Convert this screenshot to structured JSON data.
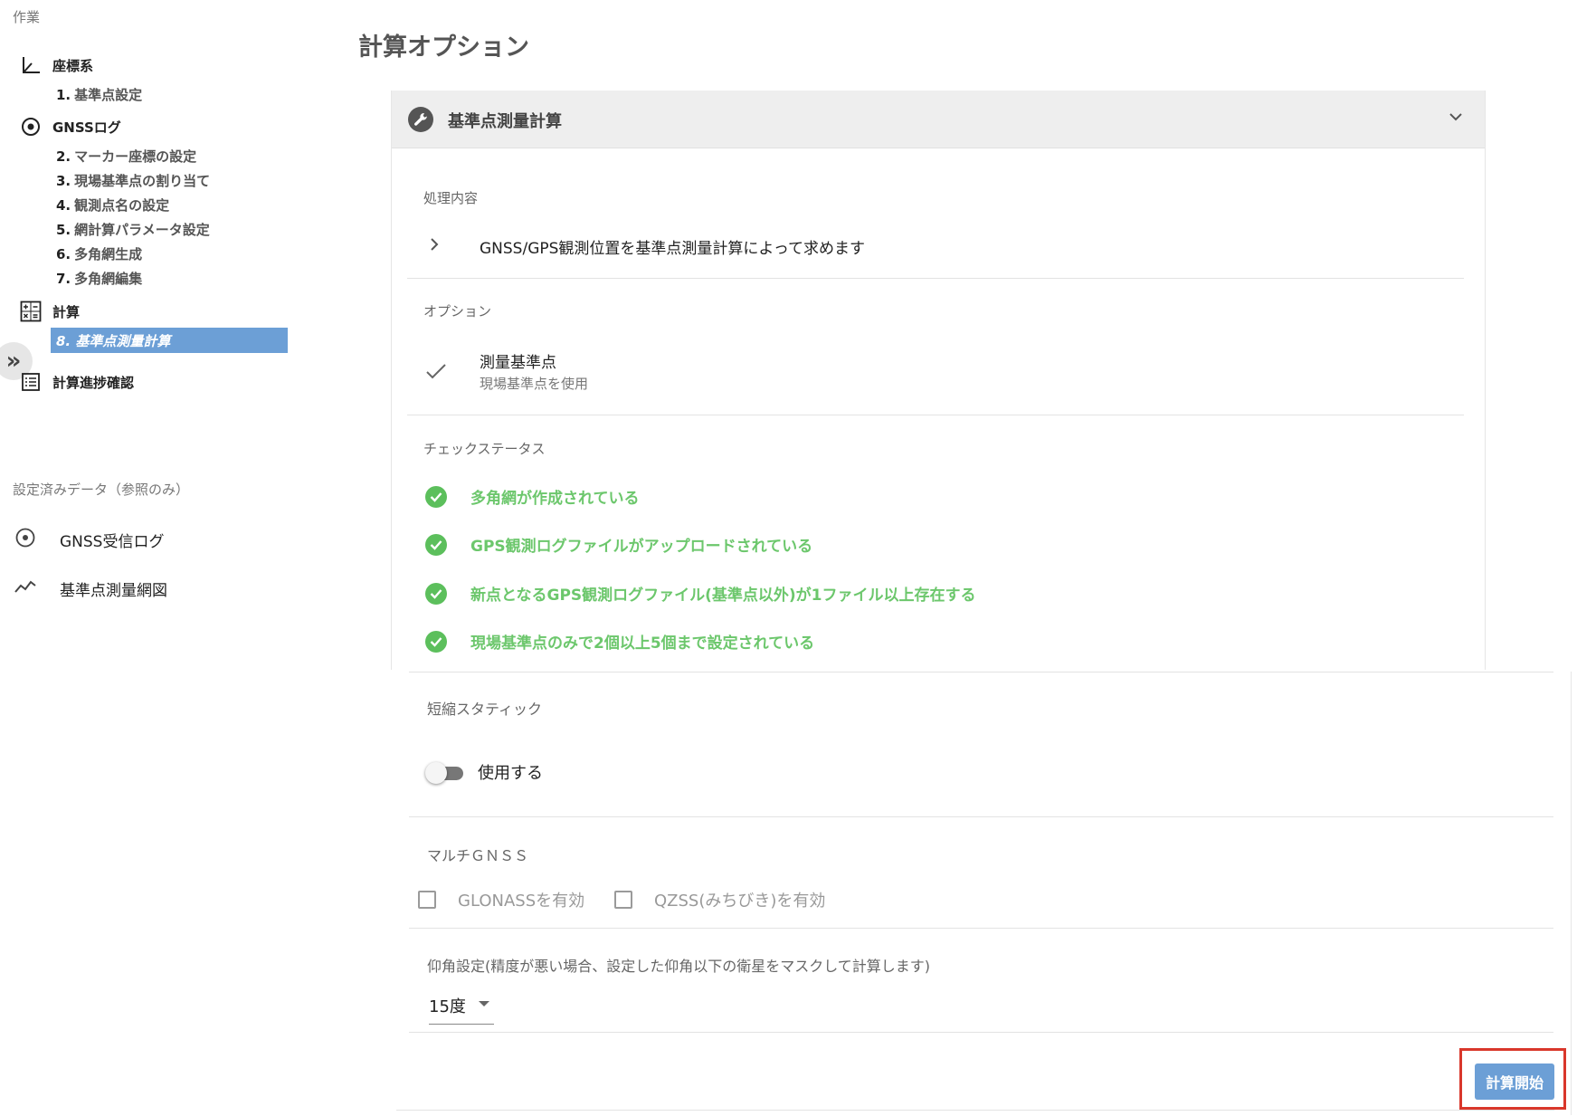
{
  "sidebar": {
    "work_label": "作業",
    "coord_group": "座標系",
    "coord_items": [
      {
        "num": "1.",
        "label": "基準点設定"
      }
    ],
    "gnss_group": "GNSSログ",
    "gnss_items": [
      {
        "num": "2.",
        "label": "マーカー座標の設定"
      },
      {
        "num": "3.",
        "label": "現場基準点の割り当て"
      },
      {
        "num": "4.",
        "label": "観測点名の設定"
      },
      {
        "num": "5.",
        "label": "網計算パラメータ設定"
      },
      {
        "num": "6.",
        "label": "多角網生成"
      },
      {
        "num": "7.",
        "label": "多角網編集"
      }
    ],
    "calc_group": "計算",
    "active_item": "8. 基準点測量計算",
    "progress_group": "計算進捗確認",
    "ref_label": "設定済みデータ（参照のみ）",
    "ref_items": [
      "GNSS受信ログ",
      "基準点測量網図"
    ]
  },
  "main": {
    "title": "計算オプション",
    "panel_title": "基準点測量計算",
    "process_label": "処理内容",
    "process_text": "GNSS/GPS観測位置を基準点測量計算によって求めます",
    "option_label": "オプション",
    "option_title": "測量基準点",
    "option_sub": "現場基準点を使用",
    "status_label": "チェックステータス",
    "checks": [
      "多角網が作成されている",
      "GPS観測ログファイルがアップロードされている",
      "新点となるGPS観測ログファイル(基準点以外)が1ファイル以上存在する",
      "現場基準点のみで2個以上5個まで設定されている"
    ],
    "static_label": "短縮スタティック",
    "static_toggle": "使用する",
    "multi_label": "マルチＧＮＳＳ",
    "glonass": "GLONASSを有効",
    "qzss": "QZSS(みちびき)を有効",
    "elevation_label": "仰角設定(精度が悪い場合、設定した仰角以下の衛星をマスクして計算します)",
    "elevation_value": "15度",
    "start_button": "計算開始"
  },
  "colors": {
    "accent": "#6c9fd6",
    "success": "#5cbf5c",
    "highlight": "#d9372b"
  }
}
